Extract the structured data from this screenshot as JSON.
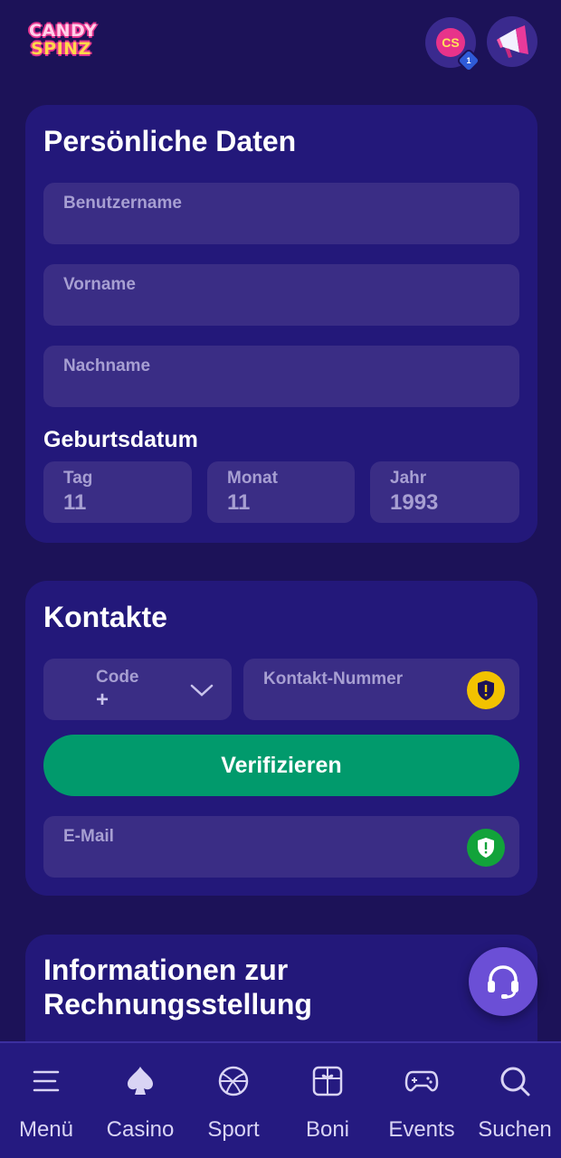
{
  "header": {
    "logo_line1": "CANDY",
    "logo_line2": "SPINZ",
    "avatar_initials": "CS",
    "avatar_badge": "1",
    "icons": {
      "avatar": "user-avatar",
      "promo": "megaphone-icon"
    }
  },
  "personal": {
    "title": "Persönliche Daten",
    "username_label": "Benutzername",
    "firstname_label": "Vorname",
    "lastname_label": "Nachname",
    "birthdate_label": "Geburtsdatum",
    "day_label": "Tag",
    "day_value": "11",
    "month_label": "Monat",
    "month_value": "11",
    "year_label": "Jahr",
    "year_value": "1993"
  },
  "contacts": {
    "title": "Kontakte",
    "code_label": "Code",
    "code_value": "+",
    "phone_label": "Kontakt-Nummer",
    "verify_label": "Verifizieren",
    "email_label": "E-Mail",
    "phone_status_color": "#f2c200",
    "email_status_color": "#12a33a"
  },
  "billing": {
    "title_line1": "Informationen zur",
    "title_line2": "Rechnungsstellung"
  },
  "support": {
    "icon": "headset-icon"
  },
  "nav": {
    "items": [
      {
        "label": "Menü",
        "icon": "menu-icon"
      },
      {
        "label": "Casino",
        "icon": "spade-icon"
      },
      {
        "label": "Sport",
        "icon": "ball-icon"
      },
      {
        "label": "Boni",
        "icon": "gift-icon"
      },
      {
        "label": "Events",
        "icon": "gamepad-icon"
      },
      {
        "label": "Suchen",
        "icon": "search-icon"
      }
    ]
  },
  "colors": {
    "background": "#1c1258",
    "card": "#23187a",
    "field": "#3a2d85",
    "accent_green": "#019a6c",
    "support": "#6b4fd6"
  }
}
